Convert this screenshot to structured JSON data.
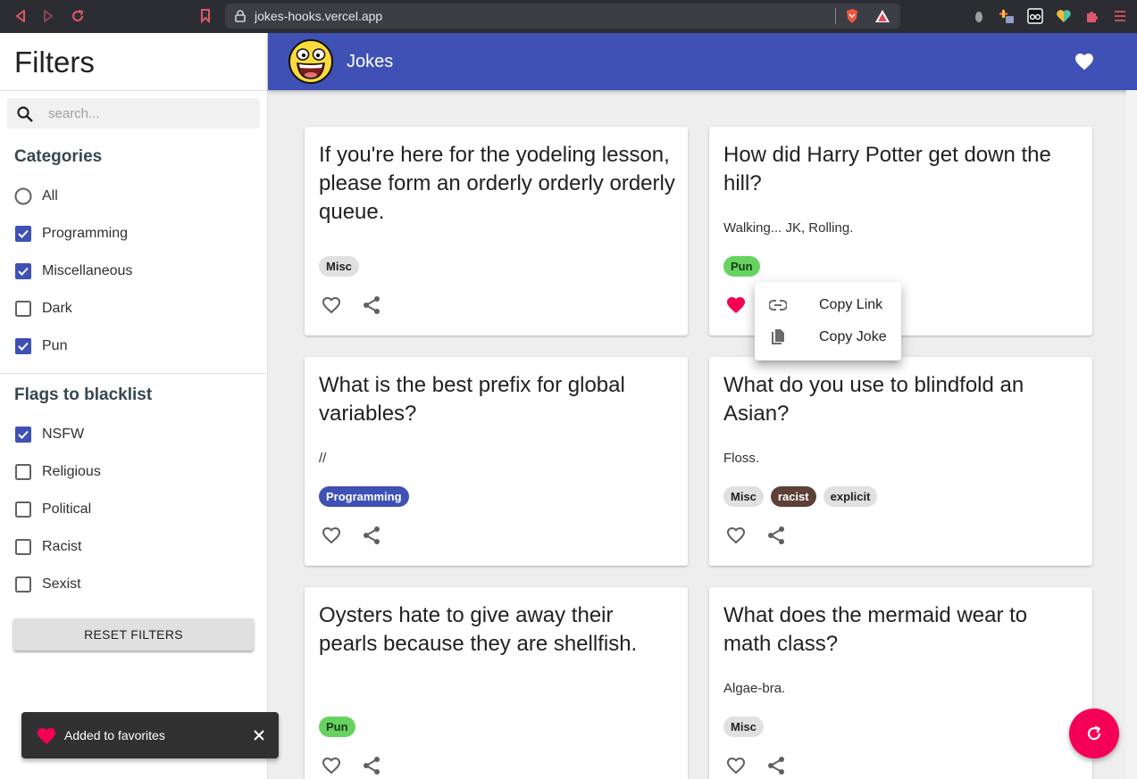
{
  "browser": {
    "url": "jokes-hooks.vercel.app"
  },
  "sidebar": {
    "title": "Filters",
    "search_placeholder": "search...",
    "categories_title": "Categories",
    "categories": [
      {
        "label": "All",
        "type": "radio",
        "checked": false
      },
      {
        "label": "Programming",
        "type": "checkbox",
        "checked": true
      },
      {
        "label": "Miscellaneous",
        "type": "checkbox",
        "checked": true
      },
      {
        "label": "Dark",
        "type": "checkbox",
        "checked": false
      },
      {
        "label": "Pun",
        "type": "checkbox",
        "checked": true
      }
    ],
    "flags_title": "Flags to blacklist",
    "flags": [
      {
        "label": "NSFW",
        "checked": true
      },
      {
        "label": "Religious",
        "checked": false
      },
      {
        "label": "Political",
        "checked": false
      },
      {
        "label": "Racist",
        "checked": false
      },
      {
        "label": "Sexist",
        "checked": false
      }
    ],
    "reset_label": "RESET FILTERS"
  },
  "appbar": {
    "title": "Jokes"
  },
  "jokes": [
    {
      "setup": "If you're here for the yodeling lesson, please form an orderly orderly orderly queue.",
      "delivery": "",
      "tags": [
        "Misc"
      ],
      "favorited": false
    },
    {
      "setup": "How did Harry Potter get down the hill?",
      "delivery": "Walking... JK, Rolling.",
      "tags": [
        "Pun"
      ],
      "favorited": true
    },
    {
      "setup": "What is the best prefix for global variables?",
      "delivery": "//",
      "tags": [
        "Programming"
      ],
      "favorited": false
    },
    {
      "setup": "What do you use to blindfold an Asian?",
      "delivery": "Floss.",
      "tags": [
        "Misc",
        "racist",
        "explicit"
      ],
      "favorited": false
    },
    {
      "setup": "Oysters hate to give away their pearls because they are shellfish.",
      "delivery": "",
      "tags": [
        "Pun"
      ],
      "favorited": false
    },
    {
      "setup": "What does the mermaid wear to math class?",
      "delivery": "Algae-bra.",
      "tags": [
        "Misc"
      ],
      "favorited": false
    }
  ],
  "share_menu": {
    "items": [
      {
        "label": "Copy Link",
        "icon": "link-icon"
      },
      {
        "label": "Copy Joke",
        "icon": "copy-icon"
      }
    ]
  },
  "snackbar": {
    "message": "Added to favorites"
  },
  "colors": {
    "primary": "#3f51b5",
    "accent": "#f50057",
    "pun": "#66d361",
    "racist": "#5d4037"
  }
}
